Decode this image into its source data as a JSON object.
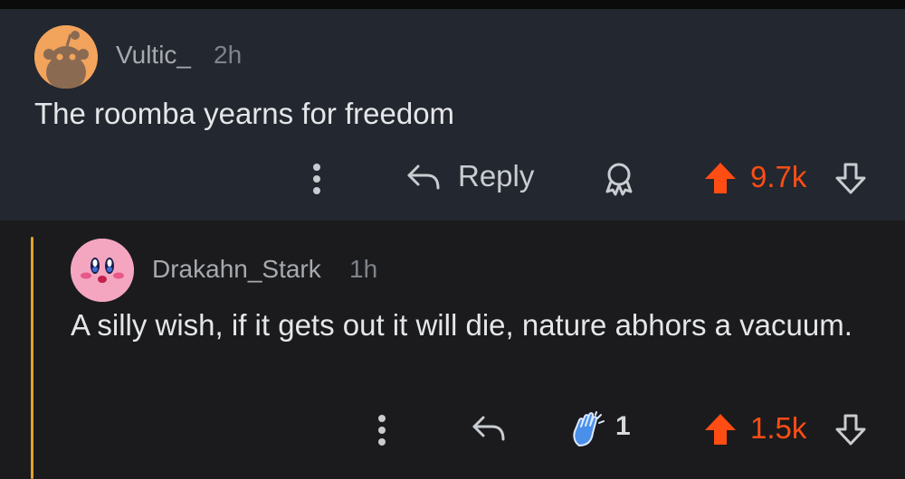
{
  "comments": [
    {
      "username": "Vultic_",
      "time": "2h",
      "body": "The roomba yearns for freedom",
      "reply_label": "Reply",
      "score": "9.7k"
    },
    {
      "username": "Drakahn_Stark",
      "time": "1h",
      "body": "A silly wish, if it gets out it will die, nature abhors a vacuum.",
      "award_count": "1",
      "score": "1.5k"
    }
  ],
  "colors": {
    "upvote": "#ff4d14",
    "thread_line": "#e3a230",
    "comment_bg_1": "#23272f",
    "comment_bg_2": "#1b1b1d"
  },
  "icons": {
    "avatar_1": "snoo-avatar-icon",
    "avatar_2": "kirby-avatar-icon",
    "more": "more-options-icon",
    "reply": "reply-arrow-icon",
    "award": "award-icon",
    "upvote": "upvote-arrow-icon",
    "downvote": "downvote-arrow-icon",
    "award_given": "clapping-hands-icon"
  }
}
